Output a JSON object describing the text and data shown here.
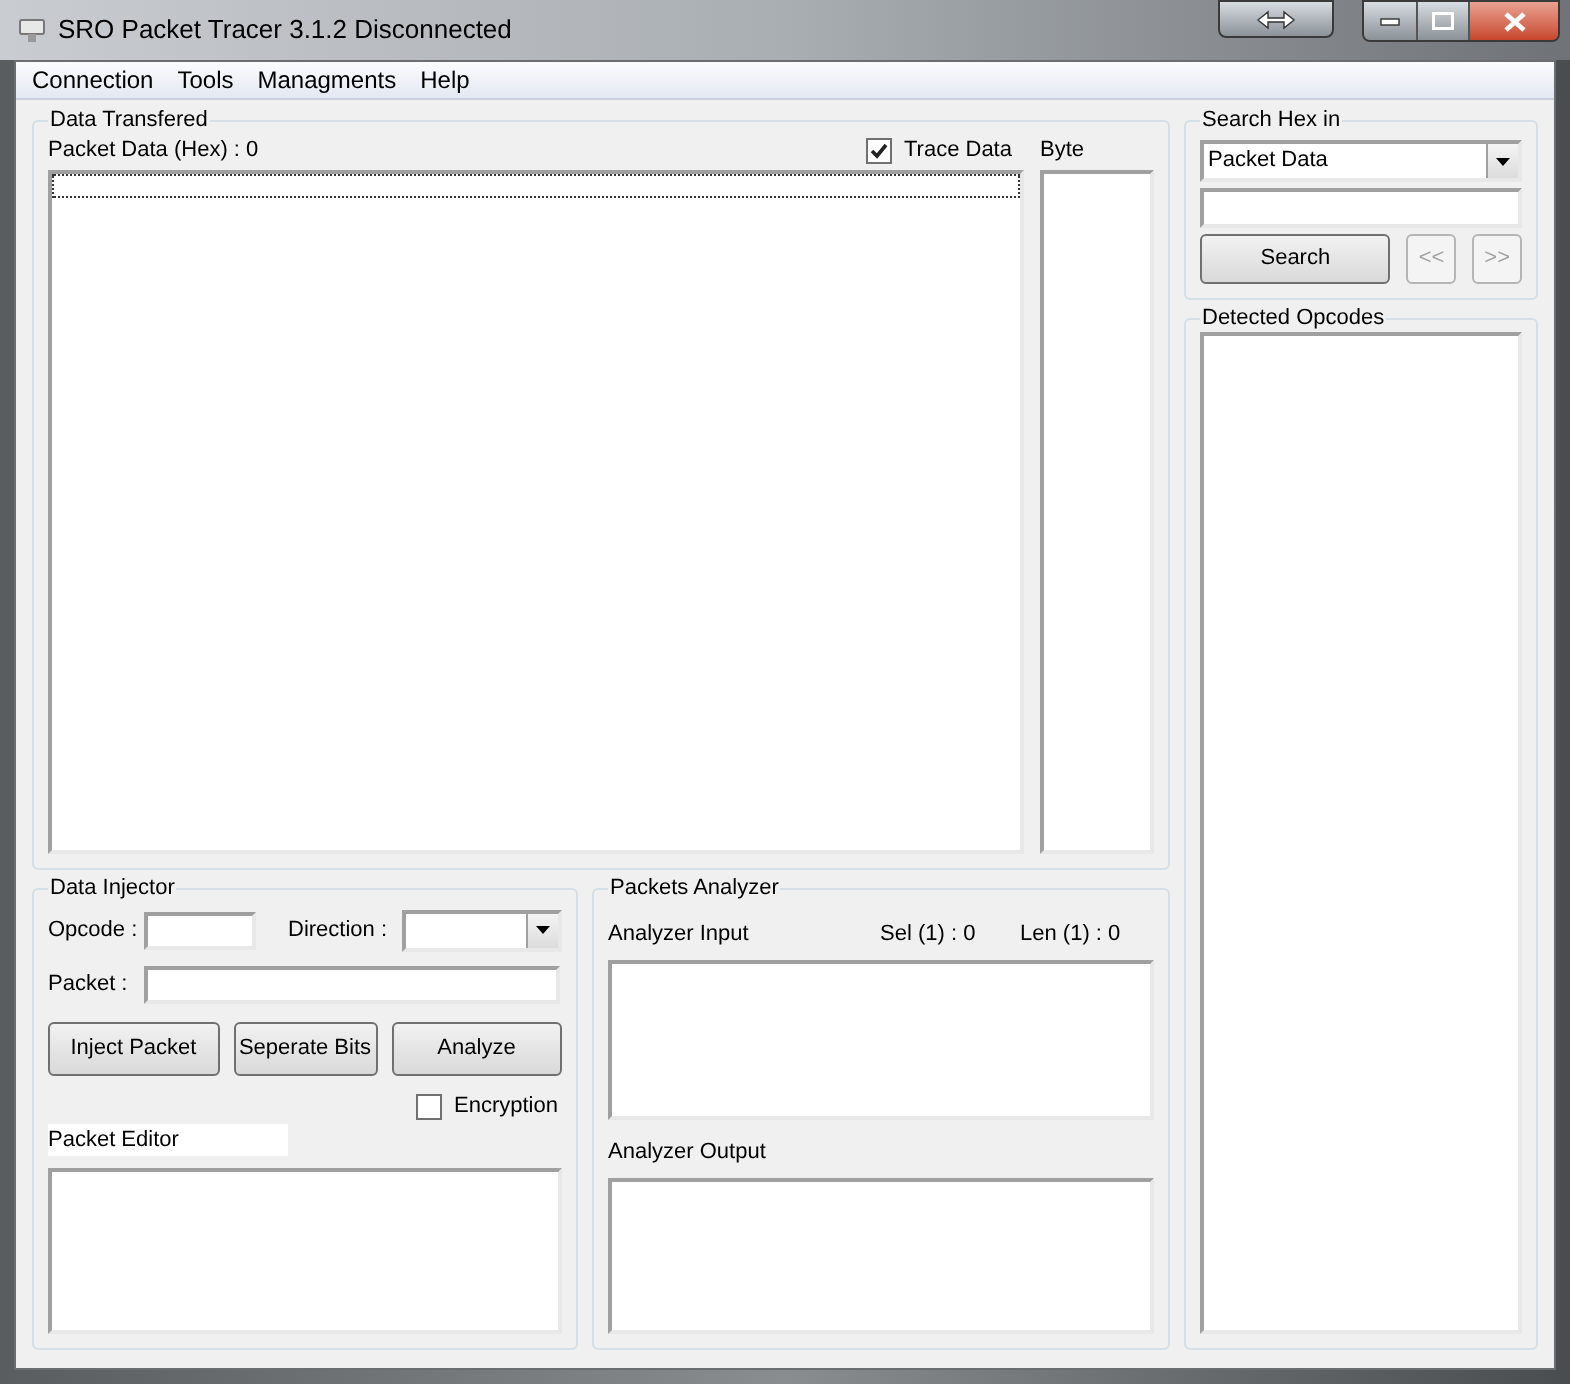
{
  "window": {
    "title": "SRO Packet Tracer 3.1.2 Disconnected"
  },
  "menu": [
    "Connection",
    "Tools",
    "Managments",
    "Help"
  ],
  "data_transfered": {
    "title": "Data Transfered",
    "packet_data_label": "Packet Data (Hex) : 0",
    "trace_data": {
      "label": "Trace Data",
      "checked": true
    },
    "byte_label": "Byte"
  },
  "search_hex": {
    "title": "Search Hex in",
    "dropdown_value": "Packet Data",
    "search_button": "Search",
    "prev_button": {
      "label": "<<",
      "disabled": true
    },
    "next_button": {
      "label": ">>",
      "disabled": true
    }
  },
  "detected_opcodes": {
    "title": "Detected Opcodes"
  },
  "data_injector": {
    "title": "Data Injector",
    "opcode_label": "Opcode :",
    "direction_label": "Direction :",
    "packet_label": "Packet :",
    "buttons": [
      "Inject Packet",
      "Seperate Bits",
      "Analyze"
    ],
    "encryption": {
      "label": "Encryption",
      "checked": false
    },
    "packet_editor_label": "Packet Editor"
  },
  "packets_analyzer": {
    "title": "Packets Analyzer",
    "input_label": "Analyzer Input",
    "sel_label": "Sel (1) : 0",
    "len_label": "Len (1) : 0",
    "output_label": "Analyzer Output"
  }
}
